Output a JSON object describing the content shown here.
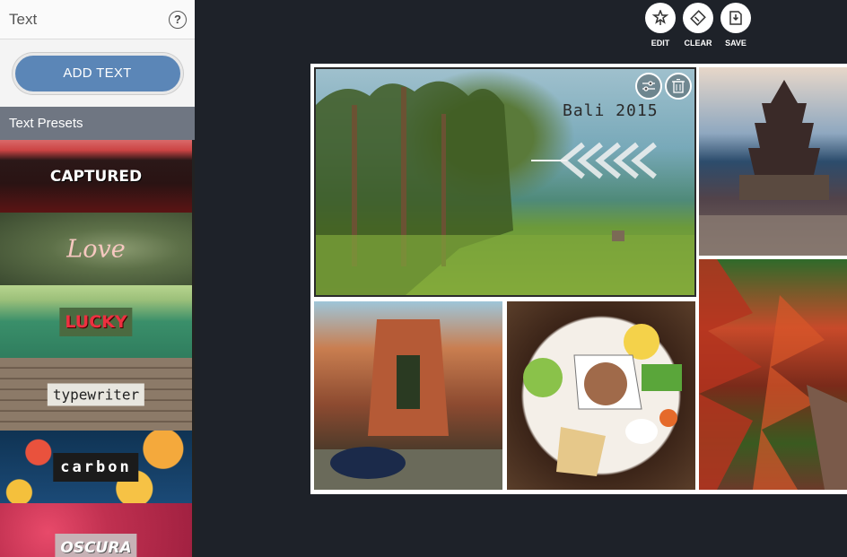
{
  "sidebar": {
    "title": "Text",
    "help": "?",
    "add_text_label": "ADD TEXT",
    "presets_title": "Text Presets",
    "presets": [
      {
        "label": "CAPTURED"
      },
      {
        "label": "Love"
      },
      {
        "label": "LUCKY"
      },
      {
        "label": "typewriter"
      },
      {
        "label": "carbon"
      },
      {
        "label": "OSCURA"
      }
    ]
  },
  "toolbar": {
    "edit_label": "EDIT",
    "clear_label": "CLEAR",
    "save_label": "SAVE"
  },
  "collage": {
    "main_photo_caption": "Bali 2015"
  },
  "icons": {
    "help": "help-icon",
    "edit": "magic-wand-icon",
    "clear": "eraser-icon",
    "save": "save-icon",
    "adjust": "sliders-icon",
    "delete": "trash-icon"
  },
  "colors": {
    "accent": "#5b86b7",
    "canvas_bg": "#1e2229",
    "presets_header": "#6f7682"
  }
}
